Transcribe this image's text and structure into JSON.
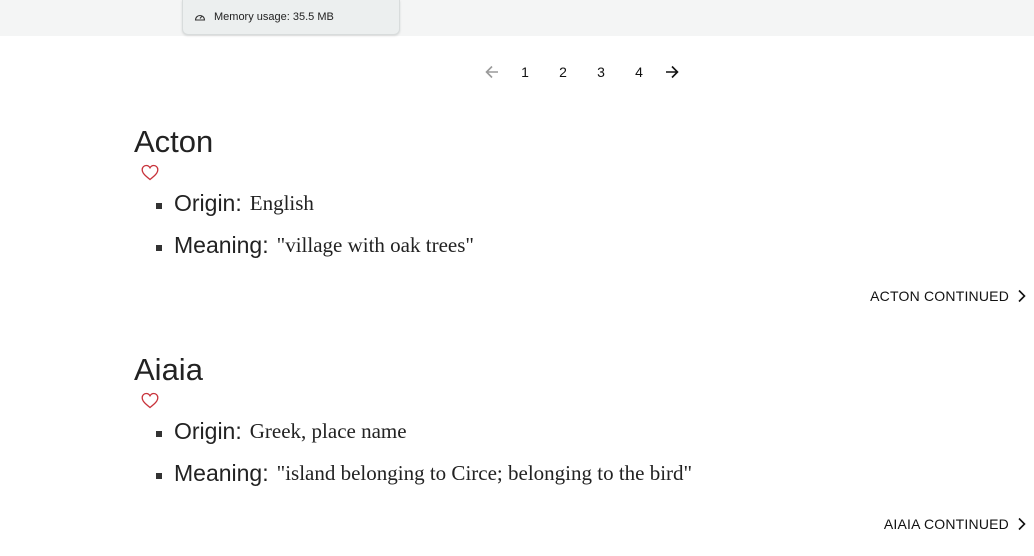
{
  "memory": {
    "label": "Memory usage: 35.5 MB"
  },
  "pagination": {
    "pages": [
      "1",
      "2",
      "3",
      "4"
    ],
    "prev_icon": "arrow-left-icon",
    "next_icon": "arrow-right-icon"
  },
  "entries": [
    {
      "name": "Acton",
      "origin_label": "Origin:",
      "origin": "English",
      "meaning_label": "Meaning:",
      "meaning": "\"village with oak trees\"",
      "continue_label": "ACTON CONTINUED"
    },
    {
      "name": "Aiaia",
      "origin_label": "Origin:",
      "origin": "Greek, place name",
      "meaning_label": "Meaning:",
      "meaning": "\"island belonging to Circe; belonging to the bird\"",
      "continue_label": "AIAIA CONTINUED"
    }
  ],
  "colors": {
    "heart": "#c8323a",
    "text": "#222222",
    "topbar": "#f4f5f5"
  }
}
